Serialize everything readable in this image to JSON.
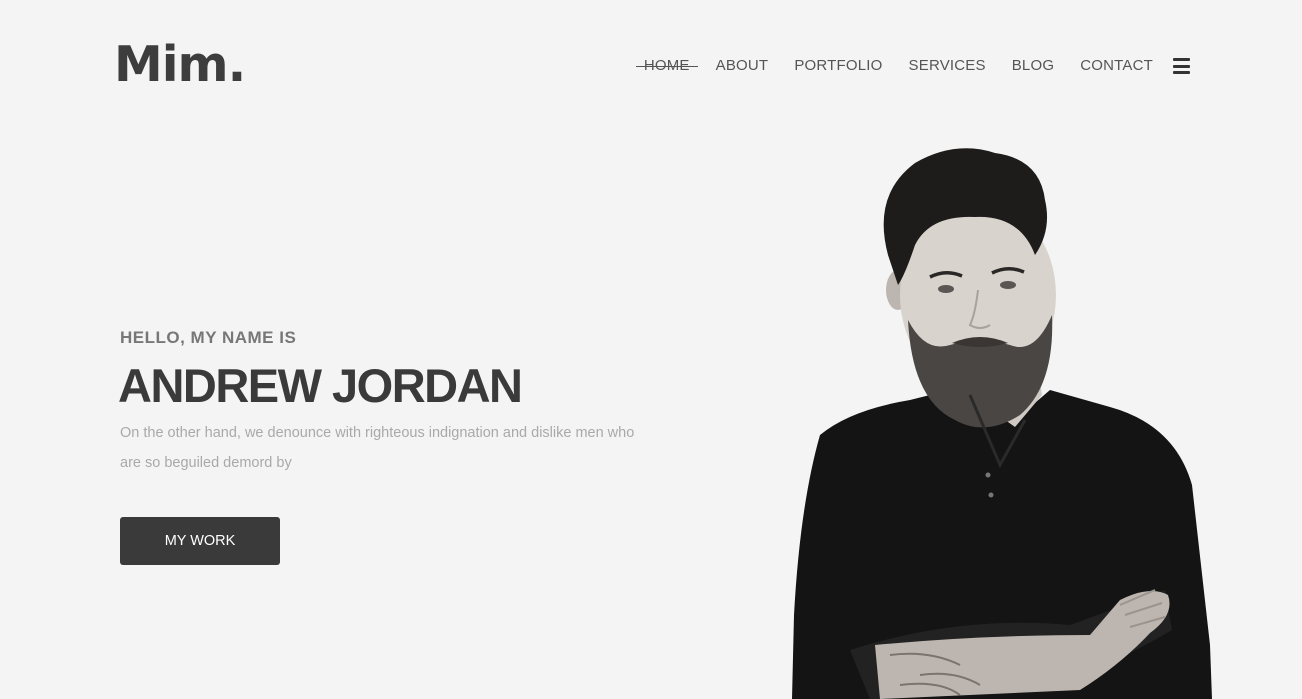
{
  "header": {
    "logo": "Mim.",
    "nav": [
      "HOME",
      "ABOUT",
      "PORTFOLIO",
      "SERVICES",
      "BLOG",
      "CONTACT"
    ],
    "active_item": "HOME",
    "menu_icon": "hamburger-icon"
  },
  "hero": {
    "greeting": "HELLO, MY NAME IS",
    "name": "ANDREW JORDAN",
    "description": "On the other hand, we denounce with righteous indignation and dislike men who are so beguiled demord by",
    "button_label": "MY WORK"
  },
  "colors": {
    "background": "#f4f4f4",
    "text_dark": "#3a3a3a",
    "text_muted": "#a9a9a9",
    "button_bg": "#3a3a3a"
  }
}
